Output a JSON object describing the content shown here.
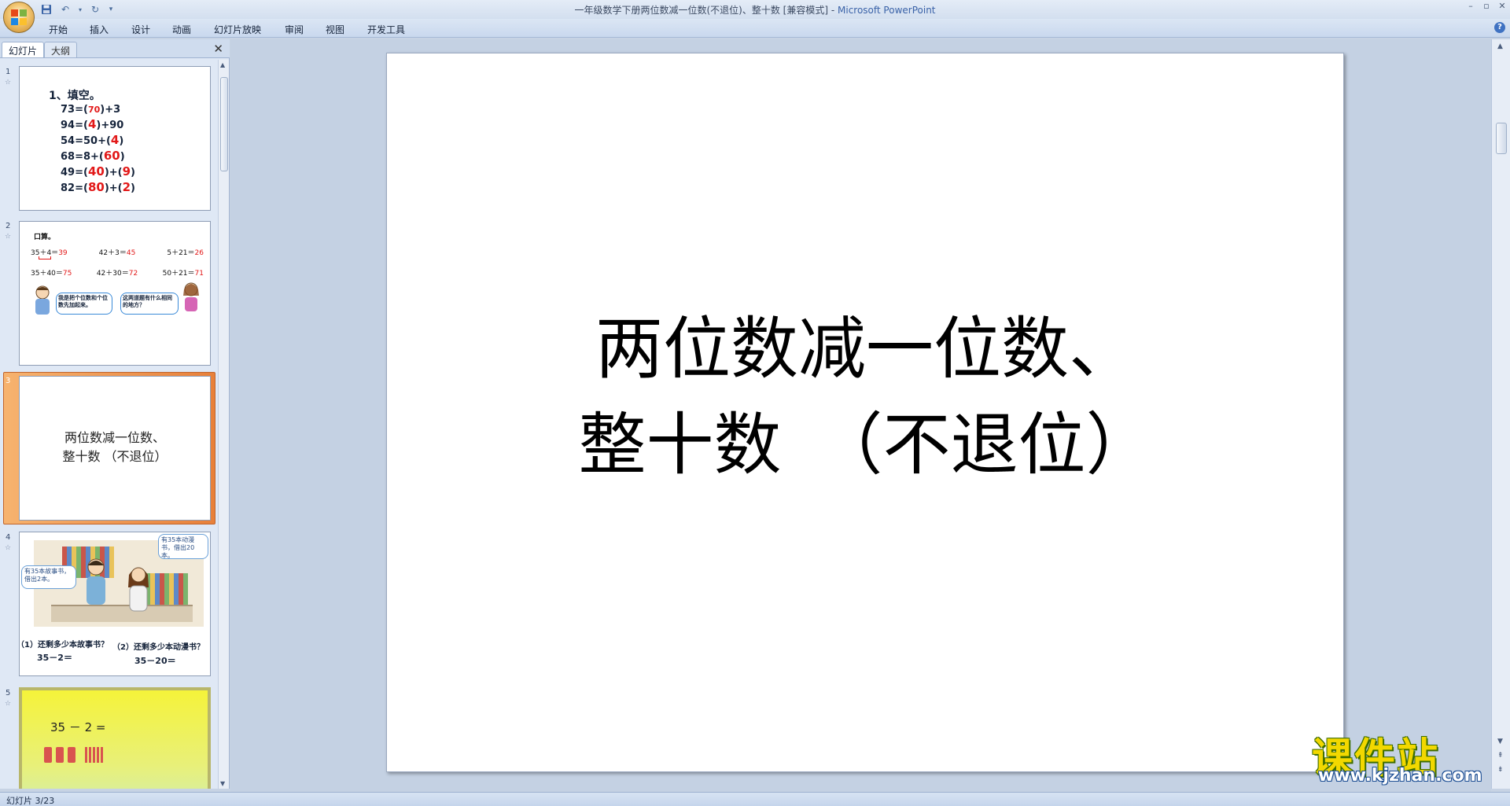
{
  "window": {
    "title": "一年级数学下册两位数减一位数(不退位)、整十数 [兼容模式]",
    "title_sep": " - ",
    "app_name": "Microsoft PowerPoint"
  },
  "ribbon": {
    "tabs": [
      "开始",
      "插入",
      "设计",
      "动画",
      "幻灯片放映",
      "审阅",
      "视图",
      "开发工具"
    ]
  },
  "panel": {
    "tab_slides": "幻灯片",
    "tab_outline": "大纲"
  },
  "thumbnails": {
    "s1": {
      "num": "1",
      "heading": "1、填空。",
      "rows": [
        {
          "pre": "73=(",
          "a": "70",
          "post": ")+3"
        },
        {
          "pre": "94=(",
          "a": "4",
          "post": ")+90"
        },
        {
          "pre": "54=50+(",
          "a": "4",
          "post": ")"
        },
        {
          "pre": "68=8+(",
          "a": "60",
          "post": ")"
        },
        {
          "pre": "49=(",
          "a": "40",
          "mid": ")+(",
          "b": "9",
          "post": ")"
        },
        {
          "pre": "82=(",
          "a": "80",
          "mid": ")+(",
          "b": "2",
          "post": ")"
        }
      ]
    },
    "s2": {
      "num": "2",
      "heading": "口算。",
      "row1": [
        {
          "q": "35＋4＝",
          "a": "39"
        },
        {
          "q": "42＋3＝",
          "a": "45"
        },
        {
          "q": "5＋21＝",
          "a": "26"
        }
      ],
      "row2": [
        {
          "q": "35＋40＝",
          "a": "75"
        },
        {
          "q": "42＋30＝",
          "a": "72"
        },
        {
          "q": "50＋21＝",
          "a": "71"
        }
      ],
      "bubble_left": "我是把个位数和个位数先加起来。",
      "bubble_right": "这两道题有什么相同的地方？"
    },
    "s3": {
      "num": "3",
      "line1": "两位数减一位数、",
      "line2": "整十数 （不退位）"
    },
    "s4": {
      "num": "4",
      "bubble_left": "有35本故事书，借出2本。",
      "bubble_right": "有35本动漫书，借出20本。",
      "q1": "（1）还剩多少本故事书？",
      "e1": "35－2＝",
      "q2": "（2）还剩多少本动漫书？",
      "e2": "35－20＝"
    },
    "s5": {
      "num": "5",
      "expr": "35 － 2 ="
    }
  },
  "slide": {
    "line1": "两位数减一位数、",
    "line2": "整十数　（不退位）"
  },
  "status": {
    "text": "幻灯片 3/23"
  },
  "watermark": {
    "title": "课件站",
    "url": "www.kjzhan.com"
  }
}
